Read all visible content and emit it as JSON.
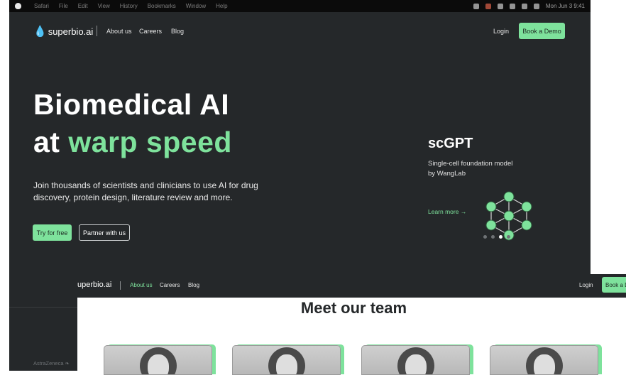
{
  "menubar": {
    "items": [
      "Safari",
      "File",
      "Edit",
      "View",
      "History",
      "Bookmarks",
      "Window",
      "Help"
    ],
    "clock": "Mon Jun 3  9:41"
  },
  "site": {
    "logo": "superbio.ai",
    "logo_partial": "uperbio.ai",
    "nav": {
      "about": "About us",
      "careers": "Careers",
      "blog": "Blog"
    },
    "login": "Login",
    "demo": "Book a Demo",
    "demo_partial": "Book a D"
  },
  "hero": {
    "line1": "Biomedical AI",
    "line2_prefix": "at ",
    "line2_accent": "warp speed",
    "subtitle": "Join thousands of scientists and clinicians to use AI for drug discovery, protein design, literature review and more.",
    "cta_primary": "Try for free",
    "cta_secondary": "Partner with us"
  },
  "feature": {
    "title": "scGPT",
    "description": "Single-cell foundation model by WangLab",
    "learn_more": "Learn more →",
    "carousel_active_index": 2,
    "carousel_count": 4
  },
  "team": {
    "title": "Meet our team",
    "members": 4
  },
  "partner_logo": "AstraZeneca",
  "colors": {
    "accent": "#7ee29c",
    "dark_bg": "#25282a"
  }
}
